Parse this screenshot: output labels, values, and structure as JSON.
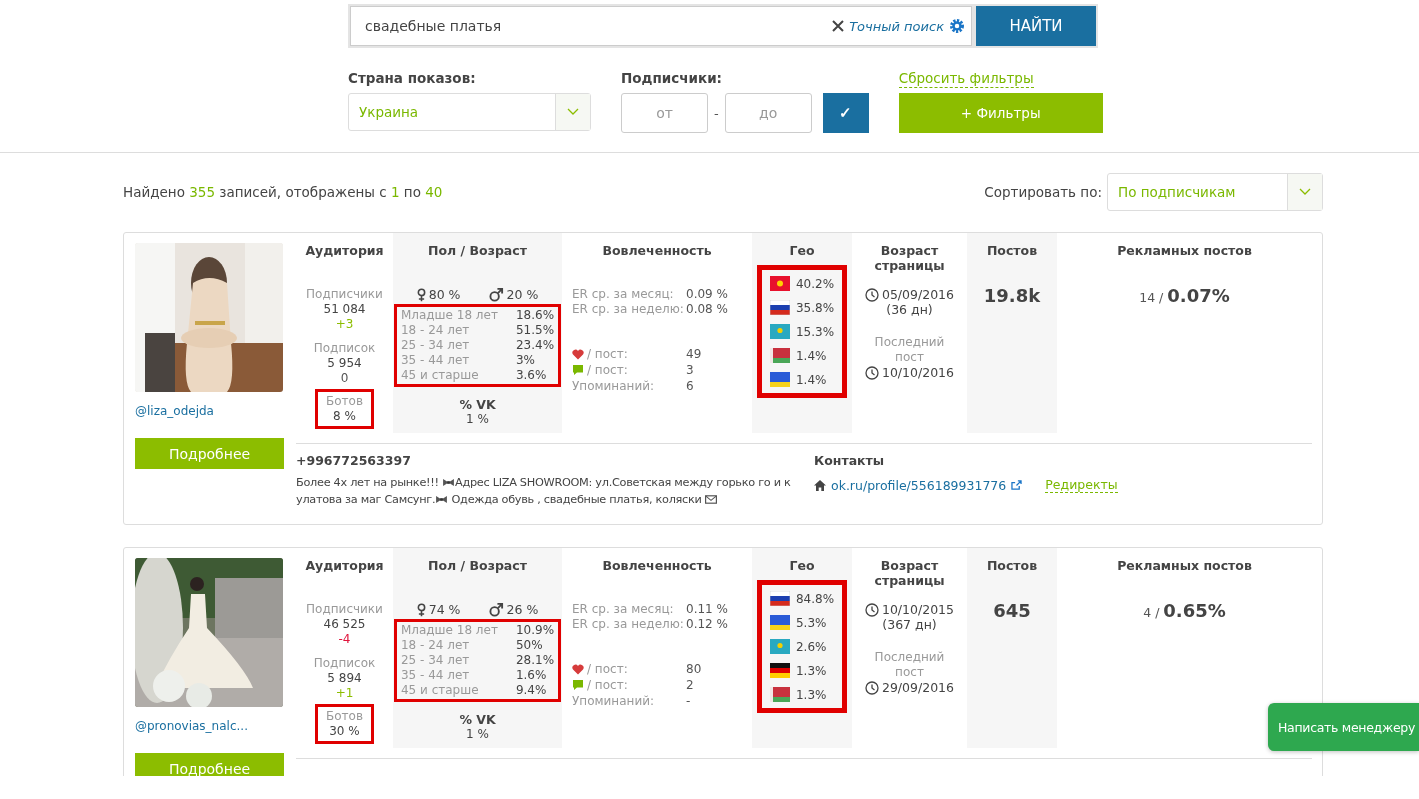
{
  "search": {
    "value": "свадебные платья",
    "exact_label": "Точный поиск",
    "submit": "НАЙТИ"
  },
  "filters": {
    "country_label": "Страна показов:",
    "country_value": "Украина",
    "subs_label": "Подписчики:",
    "from_placeholder": "от",
    "separator": "-",
    "to_placeholder": "до",
    "apply": "✓",
    "reset": "Сбросить фильтры",
    "more": "+ Фильтры"
  },
  "results": {
    "summary": [
      {
        "text": "Найдено ",
        "highlight": false
      },
      {
        "text": "355",
        "highlight": true
      },
      {
        "text": " записей, отображены с ",
        "highlight": false
      },
      {
        "text": "1",
        "highlight": true
      },
      {
        "text": " по ",
        "highlight": false
      },
      {
        "text": "40",
        "highlight": true
      }
    ],
    "sort_label": "Сортировать по:",
    "sort_value": "По подписчикам"
  },
  "cards": [
    {
      "handle": "@liza_odejda",
      "details": "Подробнее",
      "headers": [
        "Аудитория",
        "Пол / Возраст",
        "Вовлеченность",
        "Гео",
        "Возраст страницы",
        "Постов",
        "Рекламных постов"
      ],
      "subscribers_label": "Подписчики",
      "subscribers": "51 084",
      "subscribers_delta": {
        "text": "+3",
        "kind": "up"
      },
      "subscriptions_label": "Подписок",
      "subscriptions": "5 954",
      "subscriptions_delta": {
        "text": "0",
        "kind": "flat"
      },
      "bots_label": "Ботов",
      "bots": "8 %",
      "bots_highlighted": true,
      "female": "80 %",
      "male": "20 %",
      "ages": [
        {
          "label": "Младше 18 лет",
          "value": "18.6%"
        },
        {
          "label": "18 - 24 лет",
          "value": "51.5%"
        },
        {
          "label": "25 - 34 лет",
          "value": "23.4%"
        },
        {
          "label": "35 - 44 лет",
          "value": "3%"
        },
        {
          "label": "45 и старше",
          "value": "3.6%"
        }
      ],
      "ages_highlighted": true,
      "vk_label": "% VK",
      "vk": "1 %",
      "er_month_label": "ER ср. за месяц:",
      "er_month": "0.09 %",
      "er_week_label": "ER ср. за неделю:",
      "er_week": "0.08 %",
      "likes_label": "/ пост:",
      "likes": "49",
      "comments_label": "/ пост:",
      "comments": "3",
      "mentions_label": "Упоминаний:",
      "mentions": "6",
      "geo": [
        {
          "kind": "kg",
          "value": "40.2%"
        },
        {
          "kind": "ru",
          "value": "35.8%"
        },
        {
          "kind": "kz",
          "value": "15.3%"
        },
        {
          "kind": "by",
          "value": "1.4%"
        },
        {
          "kind": "ua",
          "value": "1.4%"
        }
      ],
      "geo_highlighted": true,
      "created": "05/09/2016",
      "age_days": "(36 дн)",
      "last_post_label": "Последний пост",
      "last_post": "10/10/2016",
      "posts": "19.8k",
      "ads_count": "14 /",
      "ads_share": "0.07%",
      "phone": "+996772563397",
      "description": [
        {
          "kind": "text",
          "text": "Более 4х лет на рынке!!! "
        },
        {
          "kind": "bow"
        },
        {
          "kind": "text",
          "text": "Адрес LIZA SHOWROOM: ул.Советская между горько го и кулатова за маг Самсунг."
        },
        {
          "kind": "bow"
        },
        {
          "kind": "text",
          "text": " Одежда обувь , свадебные платья, коляски "
        },
        {
          "kind": "letter"
        }
      ],
      "contacts_label": "Контакты",
      "profile_link": "ok.ru/profile/556189931776",
      "redirects": "Редиректы"
    },
    {
      "handle": "@pronovias_nalc...",
      "details": "Подробнее",
      "headers": [
        "Аудитория",
        "Пол / Возраст",
        "Вовлеченность",
        "Гео",
        "Возраст страницы",
        "Постов",
        "Рекламных постов"
      ],
      "subscribers_label": "Подписчики",
      "subscribers": "46 525",
      "subscribers_delta": {
        "text": "-4",
        "kind": "down"
      },
      "subscriptions_label": "Подписок",
      "subscriptions": "5 894",
      "subscriptions_delta": {
        "text": "+1",
        "kind": "up"
      },
      "bots_label": "Ботов",
      "bots": "30 %",
      "bots_highlighted": true,
      "female": "74 %",
      "male": "26 %",
      "ages": [
        {
          "label": "Младше 18 лет",
          "value": "10.9%"
        },
        {
          "label": "18 - 24 лет",
          "value": "50%"
        },
        {
          "label": "25 - 34 лет",
          "value": "28.1%"
        },
        {
          "label": "35 - 44 лет",
          "value": "1.6%"
        },
        {
          "label": "45 и старше",
          "value": "9.4%"
        }
      ],
      "ages_highlighted": true,
      "vk_label": "% VK",
      "vk": "1 %",
      "er_month_label": "ER ср. за месяц:",
      "er_month": "0.11 %",
      "er_week_label": "ER ср. за неделю:",
      "er_week": "0.12 %",
      "likes_label": "/ пост:",
      "likes": "80",
      "comments_label": "/ пост:",
      "comments": "2",
      "mentions_label": "Упоминаний:",
      "mentions": "-",
      "geo": [
        {
          "kind": "ru",
          "value": "84.8%"
        },
        {
          "kind": "ua",
          "value": "5.3%"
        },
        {
          "kind": "kz",
          "value": "2.6%"
        },
        {
          "kind": "de",
          "value": "1.3%"
        },
        {
          "kind": "by",
          "value": "1.3%"
        }
      ],
      "geo_highlighted": true,
      "created": "10/10/2015",
      "age_days": "(367 дн)",
      "last_post_label": "Последний пост",
      "last_post": "29/09/2016",
      "posts": "645",
      "ads_count": "4 /",
      "ads_share": "0.65%"
    }
  ],
  "chat": {
    "label": "Написать менеджеру"
  }
}
